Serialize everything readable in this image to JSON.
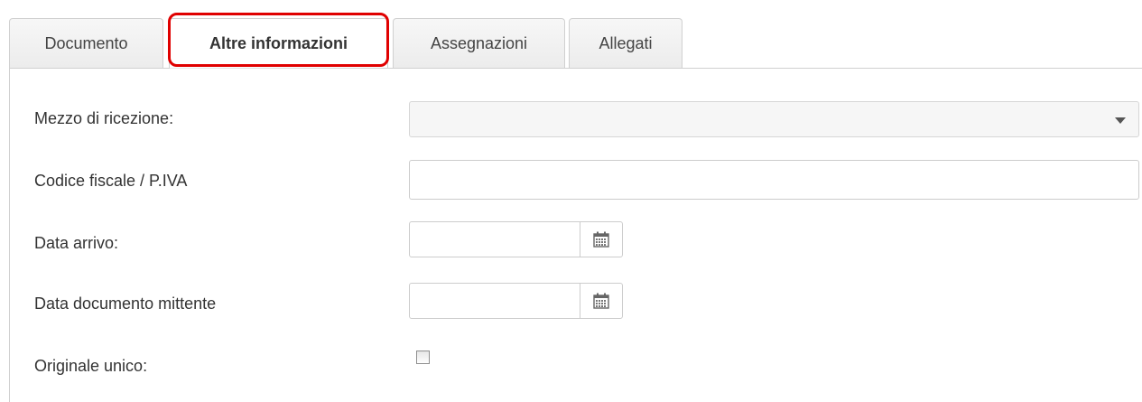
{
  "tabs": [
    {
      "label": "Documento",
      "active": false
    },
    {
      "label": "Altre informazioni",
      "active": true
    },
    {
      "label": "Assegnazioni",
      "active": false
    },
    {
      "label": "Allegati",
      "active": false
    }
  ],
  "form": {
    "mezzo_ricezione": {
      "label": "Mezzo di ricezione:",
      "value": ""
    },
    "codice_fiscale": {
      "label": "Codice fiscale / P.IVA",
      "value": ""
    },
    "data_arrivo": {
      "label": "Data arrivo:",
      "value": ""
    },
    "data_documento_mittente": {
      "label": "Data documento mittente",
      "value": ""
    },
    "originale_unico": {
      "label": "Originale unico:",
      "checked": false
    }
  },
  "icons": {
    "dropdown": "chevron-down-icon",
    "calendar": "calendar-icon"
  },
  "colors": {
    "highlight": "#e00000"
  }
}
